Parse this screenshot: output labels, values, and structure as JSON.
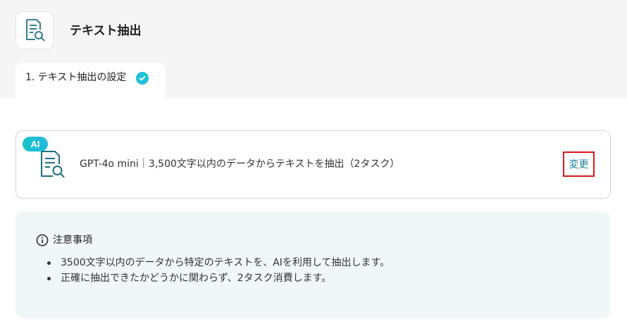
{
  "header": {
    "title": "テキスト抽出",
    "icon": "document-search-icon"
  },
  "tab": {
    "label": "1. テキスト抽出の設定",
    "status_icon": "check-circle-icon"
  },
  "action": {
    "badge": "AI",
    "icon": "document-search-icon",
    "description": "GPT-4o mini｜3,500文字以内のデータからテキストを抽出（2タスク）",
    "change_label": "変更"
  },
  "notice": {
    "icon": "info-icon",
    "title": "注意事項",
    "items": [
      "3500文字以内のデータから特定のテキストを、AIを利用して抽出します。",
      "正確に抽出できたかどうかに関わらず、2タスク消費します。"
    ]
  },
  "colors": {
    "accent": "#1fc0d8",
    "link": "#1a7f99",
    "highlight_border": "#d91818",
    "notice_bg": "#eff8f7",
    "icon_teal": "#1d6f82"
  }
}
